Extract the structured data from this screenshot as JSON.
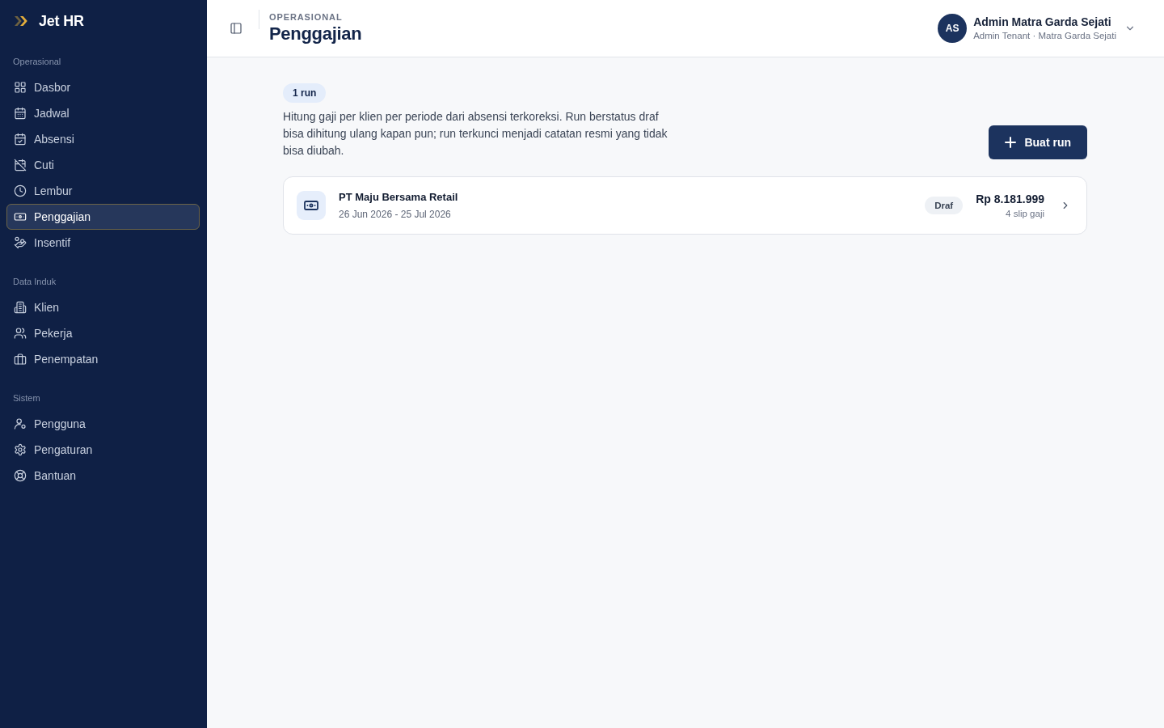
{
  "sidebar": {
    "brand": "Jet HR",
    "sections": [
      {
        "title": "Operasional",
        "items": [
          {
            "label": "Dasbor",
            "selected": false
          },
          {
            "label": "Jadwal",
            "selected": false
          },
          {
            "label": "Absensi",
            "selected": false
          },
          {
            "label": "Cuti",
            "selected": false
          },
          {
            "label": "Lembur",
            "selected": false
          },
          {
            "label": "Penggajian",
            "selected": true
          },
          {
            "label": "Insentif",
            "selected": false
          }
        ]
      },
      {
        "title": "Data Induk",
        "items": [
          {
            "label": "Klien",
            "selected": false
          },
          {
            "label": "Pekerja",
            "selected": false
          },
          {
            "label": "Penempatan",
            "selected": false
          }
        ]
      },
      {
        "title": "Sistem",
        "items": [
          {
            "label": "Pengguna",
            "selected": false
          },
          {
            "label": "Pengaturan",
            "selected": false
          },
          {
            "label": "Bantuan",
            "selected": false
          }
        ]
      }
    ]
  },
  "header": {
    "eyebrow": "OPERASIONAL",
    "title": "Penggajian",
    "user": {
      "initials": "AS",
      "name": "Admin Matra Garda Sejati",
      "subtitle": "Admin Tenant · Matra Garda Sejati"
    }
  },
  "content": {
    "count_badge": "1 run",
    "description": "Hitung gaji per klien per periode dari absensi terkoreksi. Run berstatus draf bisa dihitung ulang kapan pun; run terkunci menjadi catatan resmi yang tidak bisa diubah.",
    "create_button": "Buat run",
    "runs": [
      {
        "client": "PT Maju Bersama Retail",
        "period": "26 Jun 2026 - 25 Jul 2026",
        "status": "Draf",
        "total": "Rp 8.181.999",
        "slips": "4 slip gaji"
      }
    ]
  }
}
